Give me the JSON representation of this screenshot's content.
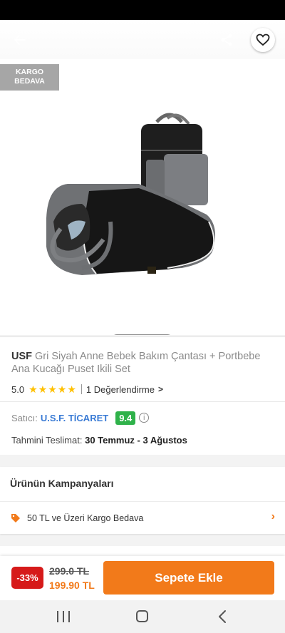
{
  "badge": {
    "line1": "KARGO",
    "line2": "BEDAVA"
  },
  "gallery": {
    "image_count": 5,
    "active_index": 0
  },
  "product": {
    "brand": "USF",
    "name": "Gri Siyah Anne Bebek Bakım Çantası + Portbebe Ana Kucağı Puset Ikili Set",
    "rating": "5.0",
    "stars": 5,
    "review_link": "1 Değerlendirme"
  },
  "seller": {
    "label": "Satıcı:",
    "name": "U.S.F. TİCARET",
    "score": "9.4",
    "score_color": "#2fb24a"
  },
  "delivery": {
    "label": "Tahmini Teslimat:",
    "value": "30 Temmuz - 3 Ağustos"
  },
  "campaigns": {
    "title": "Ürünün Kampanyaları",
    "item": "50 TL ve Üzeri Kargo Bedava"
  },
  "purchase": {
    "discount": "-33%",
    "old_price": "299.0 TL",
    "new_price": "199.90 TL",
    "button": "Sepete Ekle",
    "accent_color": "#f27a1a"
  },
  "icons": [
    "arrow-left-icon",
    "share-icon",
    "heart-icon",
    "info-icon",
    "tag-icon",
    "chevron-right-icon",
    "nav-recents-icon",
    "nav-home-icon",
    "nav-back-icon"
  ]
}
